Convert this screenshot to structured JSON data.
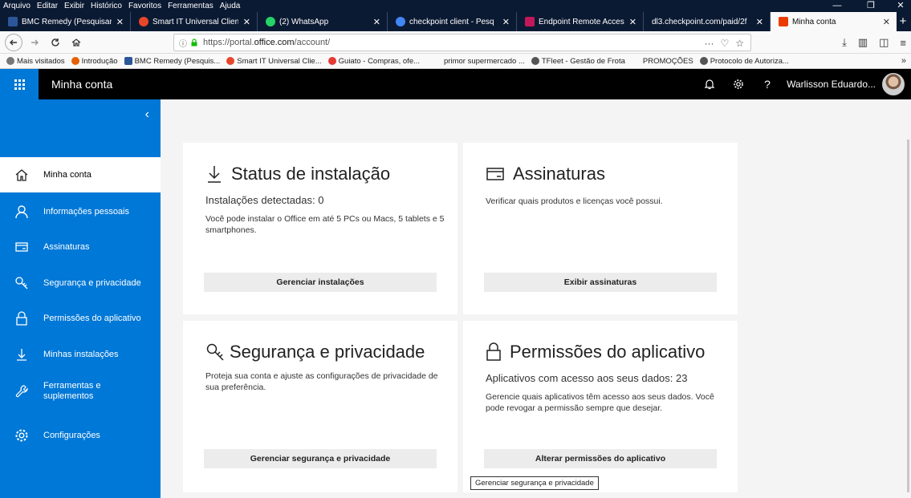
{
  "menubar": {
    "items": [
      "Arquivo",
      "Editar",
      "Exibir",
      "Histórico",
      "Favoritos",
      "Ferramentas",
      "Ajuda"
    ],
    "minimize": "—",
    "restore": "❐",
    "close": "✕"
  },
  "tabs": [
    {
      "label": "BMC Remedy (Pesquisar",
      "close": "✕",
      "fav_color": "#2b579a"
    },
    {
      "label": "Smart IT Universal Client",
      "close": "✕",
      "fav_color": "#e8462a"
    },
    {
      "label": "(2) WhatsApp",
      "close": "✕",
      "fav_color": "#25d366"
    },
    {
      "label": "checkpoint client - Pesq",
      "close": "✕",
      "fav_color": "#4285f4"
    },
    {
      "label": "Endpoint Remote Acces",
      "close": "✕",
      "fav_color": "#c2185b"
    },
    {
      "label": "dl3.checkpoint.com/paid/2f",
      "close": "✕",
      "fav_color": ""
    },
    {
      "label": "Minha conta",
      "close": "✕",
      "fav_color": "#eb3c00"
    }
  ],
  "new_tab": "+",
  "navbar": {
    "url_prefix": "https://portal.",
    "url_domain": "office.com",
    "url_suffix": "/account/",
    "url_info": "ⓘ",
    "url_menu": "···",
    "url_pocket": "♡",
    "url_star": "☆",
    "download": "⤓",
    "library": "▥",
    "sidebar": "◫",
    "menu": "≡"
  },
  "bookmarks": [
    {
      "label": "Mais visitados",
      "fav_color": "#777"
    },
    {
      "label": "Introdução",
      "fav_color": "#e66000"
    },
    {
      "label": "BMC Remedy (Pesquis...",
      "fav_color": "#2b579a"
    },
    {
      "label": "Smart IT Universal Clie...",
      "fav_color": "#e8462a"
    },
    {
      "label": "Guiato - Compras, ofe...",
      "fav_color": "#e53935"
    },
    {
      "label": "primor supermercado ...",
      "fav_color": ""
    },
    {
      "label": "TFleet - Gestão de Frota",
      "fav_color": "#555"
    },
    {
      "label": "PROMOÇÕES",
      "fav_color": ""
    },
    {
      "label": "Protocolo de Autoriza...",
      "fav_color": "#555"
    }
  ],
  "bookmarks_more": "»",
  "app": {
    "title": "Minha conta",
    "user_name": "Warlisson Eduardo...",
    "help": "?"
  },
  "sidebar": {
    "collapse": "‹",
    "items": [
      {
        "label": "Minha conta"
      },
      {
        "label": "Informações pessoais"
      },
      {
        "label": "Assinaturas"
      },
      {
        "label": "Segurança e privacidade"
      },
      {
        "label": "Permissões do aplicativo"
      },
      {
        "label": "Minhas instalações"
      },
      {
        "label": "Ferramentas e suplementos"
      },
      {
        "label": "Configurações"
      }
    ]
  },
  "cards": {
    "install": {
      "title": "Status de instalação",
      "subtitle": "Instalações detectadas: 0",
      "desc": "Você pode instalar o Office em até 5 PCs ou Macs, 5 tablets e 5 smartphones.",
      "button": "Gerenciar instalações"
    },
    "subscriptions": {
      "title": "Assinaturas",
      "desc": "Verificar quais produtos e licenças você possui.",
      "button": "Exibir assinaturas"
    },
    "security": {
      "title": "Segurança e privacidade",
      "desc": "Proteja sua conta e ajuste as configurações de privacidade de sua preferência.",
      "button": "Gerenciar segurança e privacidade"
    },
    "permissions": {
      "title": "Permissões do aplicativo",
      "subtitle": "Aplicativos com acesso aos seus dados: 23",
      "desc": "Gerencie quais aplicativos têm acesso aos seus dados. Você pode revogar a permissão sempre que desejar.",
      "button": "Alterar permissões do aplicativo"
    }
  },
  "tooltip": "Gerenciar segurança e privacidade",
  "colors": {
    "accent": "#0078d7",
    "header": "#000000",
    "titlebar": "#0b1a33"
  }
}
